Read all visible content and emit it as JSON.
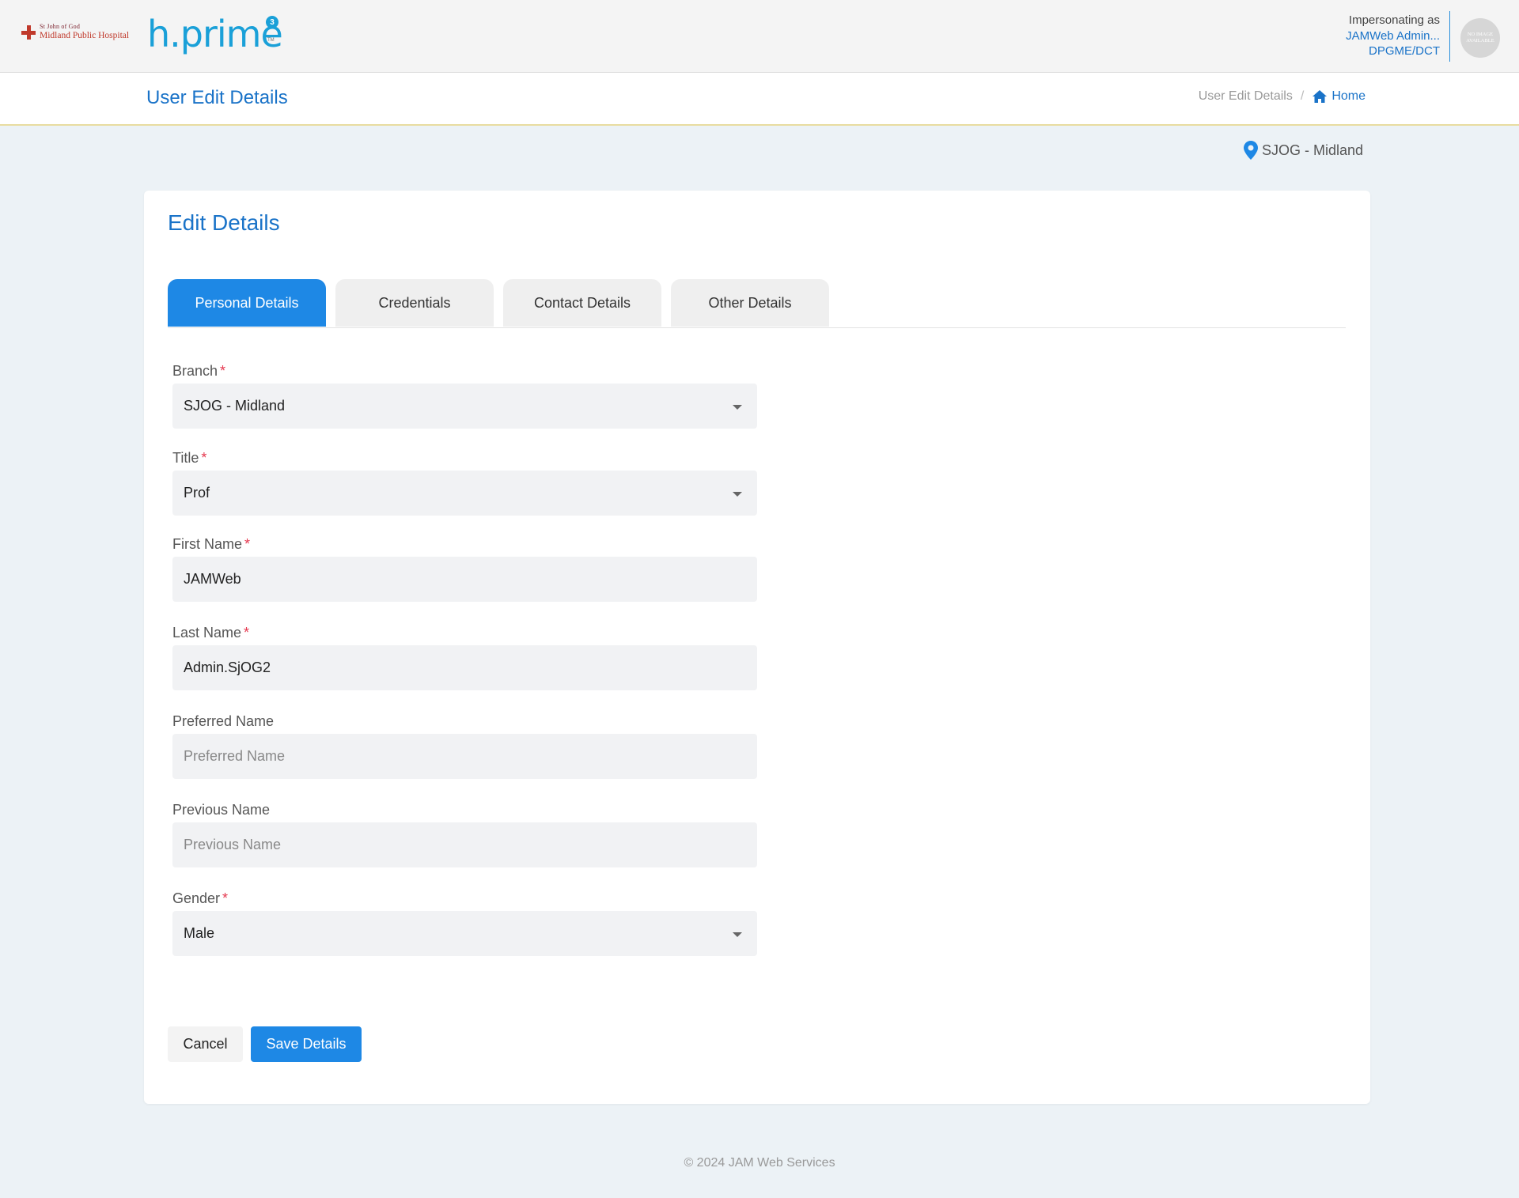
{
  "header": {
    "org_logo_line1": "St John of God",
    "org_logo_line2": "Midland Public Hospital",
    "app_logo": "h.prime",
    "app_logo_badge": "3",
    "app_logo_tm": "TM",
    "impersonating_label": "Impersonating as",
    "impersonating_user": "JAMWeb Admin...",
    "impersonating_org": "DPGME/DCT",
    "avatar_text": "No Image Available"
  },
  "page": {
    "title": "User Edit Details",
    "breadcrumb": {
      "current": "User Edit Details",
      "separator": "/",
      "home": "Home"
    },
    "location": "SJOG - Midland"
  },
  "card": {
    "title": "Edit Details",
    "tabs": [
      {
        "label": "Personal Details",
        "active": true
      },
      {
        "label": "Credentials",
        "active": false
      },
      {
        "label": "Contact Details",
        "active": false
      },
      {
        "label": "Other Details",
        "active": false
      }
    ]
  },
  "form": {
    "branch": {
      "label": "Branch",
      "required": "*",
      "value": "SJOG - Midland"
    },
    "title": {
      "label": "Title",
      "required": "*",
      "value": "Prof"
    },
    "first_name": {
      "label": "First Name",
      "required": "*",
      "value": "JAMWeb"
    },
    "last_name": {
      "label": "Last Name",
      "required": "*",
      "value": "Admin.SjOG2"
    },
    "preferred_name": {
      "label": "Preferred Name",
      "placeholder": "Preferred Name",
      "value": ""
    },
    "previous_name": {
      "label": "Previous Name",
      "placeholder": "Previous Name",
      "value": ""
    },
    "gender": {
      "label": "Gender",
      "required": "*",
      "value": "Male"
    }
  },
  "actions": {
    "cancel": "Cancel",
    "save": "Save Details"
  },
  "footer": {
    "copyright": "© 2024 JAM Web Services"
  },
  "colors": {
    "primary": "#1e88e5",
    "link": "#1a73c8",
    "required": "#e53950",
    "page_bg": "#ecf2f6"
  }
}
